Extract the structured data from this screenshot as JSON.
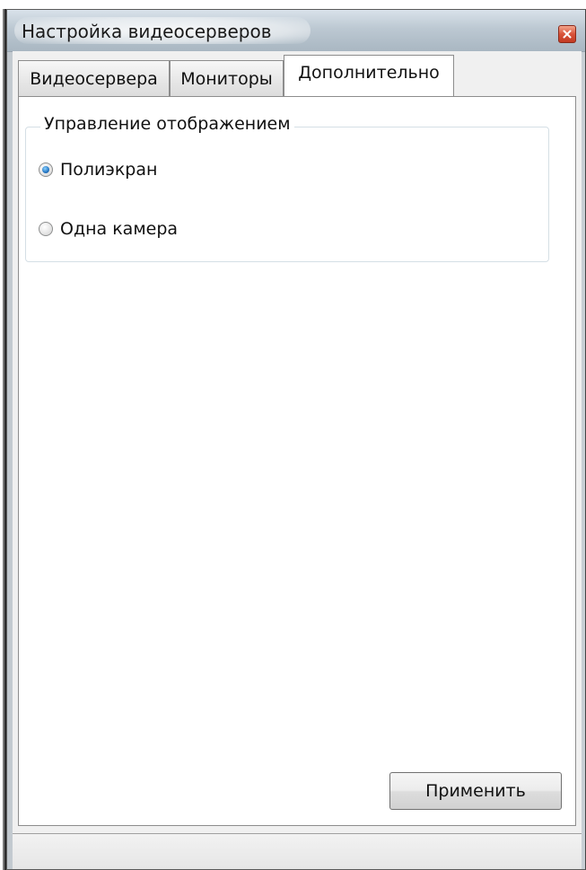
{
  "window": {
    "title": "Настройка видеосерверов"
  },
  "tabs": [
    {
      "label": "Видеосервера",
      "selected": false
    },
    {
      "label": "Мониторы",
      "selected": false
    },
    {
      "label": "Дополнительно",
      "selected": true
    }
  ],
  "display_group": {
    "title": "Управление отображением",
    "options": [
      {
        "label": "Полиэкран",
        "checked": true
      },
      {
        "label": "Одна камера",
        "checked": false
      }
    ]
  },
  "buttons": {
    "apply_label": "Применить"
  },
  "icons": {
    "close": "close-icon"
  },
  "colors": {
    "close_button": "#d9533a",
    "radio_selected": "#2a7cc8"
  }
}
